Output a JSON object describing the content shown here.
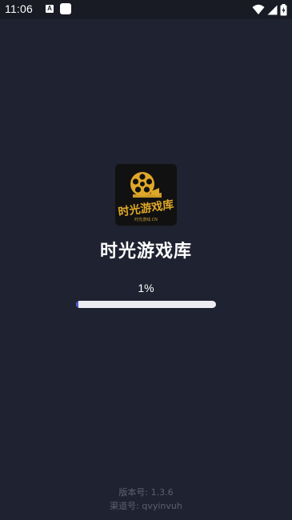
{
  "status_bar": {
    "time": "11:06",
    "a_badge": "A",
    "icons": [
      "a-notification-icon",
      "square-notification-icon",
      "wifi-icon",
      "signal-icon",
      "battery-charging-icon"
    ]
  },
  "app": {
    "title": "时光游戏库",
    "logo_text": "时光游戏库",
    "logo_subtext": "时光游戏.CN"
  },
  "progress": {
    "label": "1%",
    "fraction": 0.01,
    "fill_color": "#4a56d6"
  },
  "footer": {
    "version": "版本号: 1.3.6",
    "channel": "渠道号: qvyinvuh"
  },
  "colors": {
    "background": "#1f2230",
    "accent_gold": "#e0a828"
  }
}
